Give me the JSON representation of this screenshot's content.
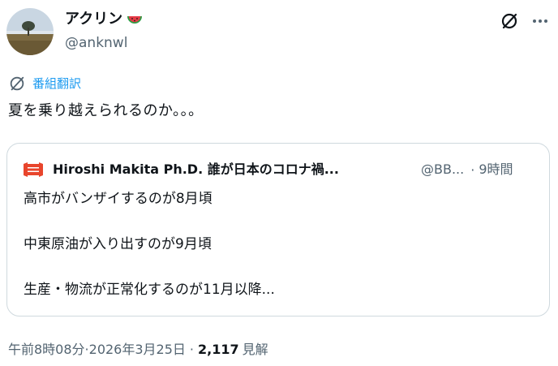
{
  "author": {
    "display_name": "アクリン",
    "emoji": "watermelon-emoji",
    "handle": "@anknwl"
  },
  "header_actions": {
    "grok_icon": "grok-icon",
    "more_icon": "more-dots-icon"
  },
  "translate": {
    "label": "番組翻訳",
    "icon": "grok-icon"
  },
  "tweet": {
    "text": "夏を乗り越えられるのか。。。"
  },
  "quote": {
    "author_name": "Hiroshi Makita Ph.D. 誰が日本のコロナ禍...",
    "handle": "@BB...",
    "separator": "·",
    "time": "9時間",
    "lines": [
      "高市がバンザイするのが8月頃",
      "中東原油が入り出すのが9月頃",
      "生産・物流が正常化するのが11月以降..."
    ]
  },
  "meta": {
    "time": "午前8時08分",
    "date": "·2026年3月25日",
    "separator": "·",
    "views_count": "2,117",
    "views_label": "見解"
  },
  "colors": {
    "accent": "#1d9bf0",
    "text": "#0f1419",
    "secondary": "#536471",
    "border": "#cfd9de"
  }
}
